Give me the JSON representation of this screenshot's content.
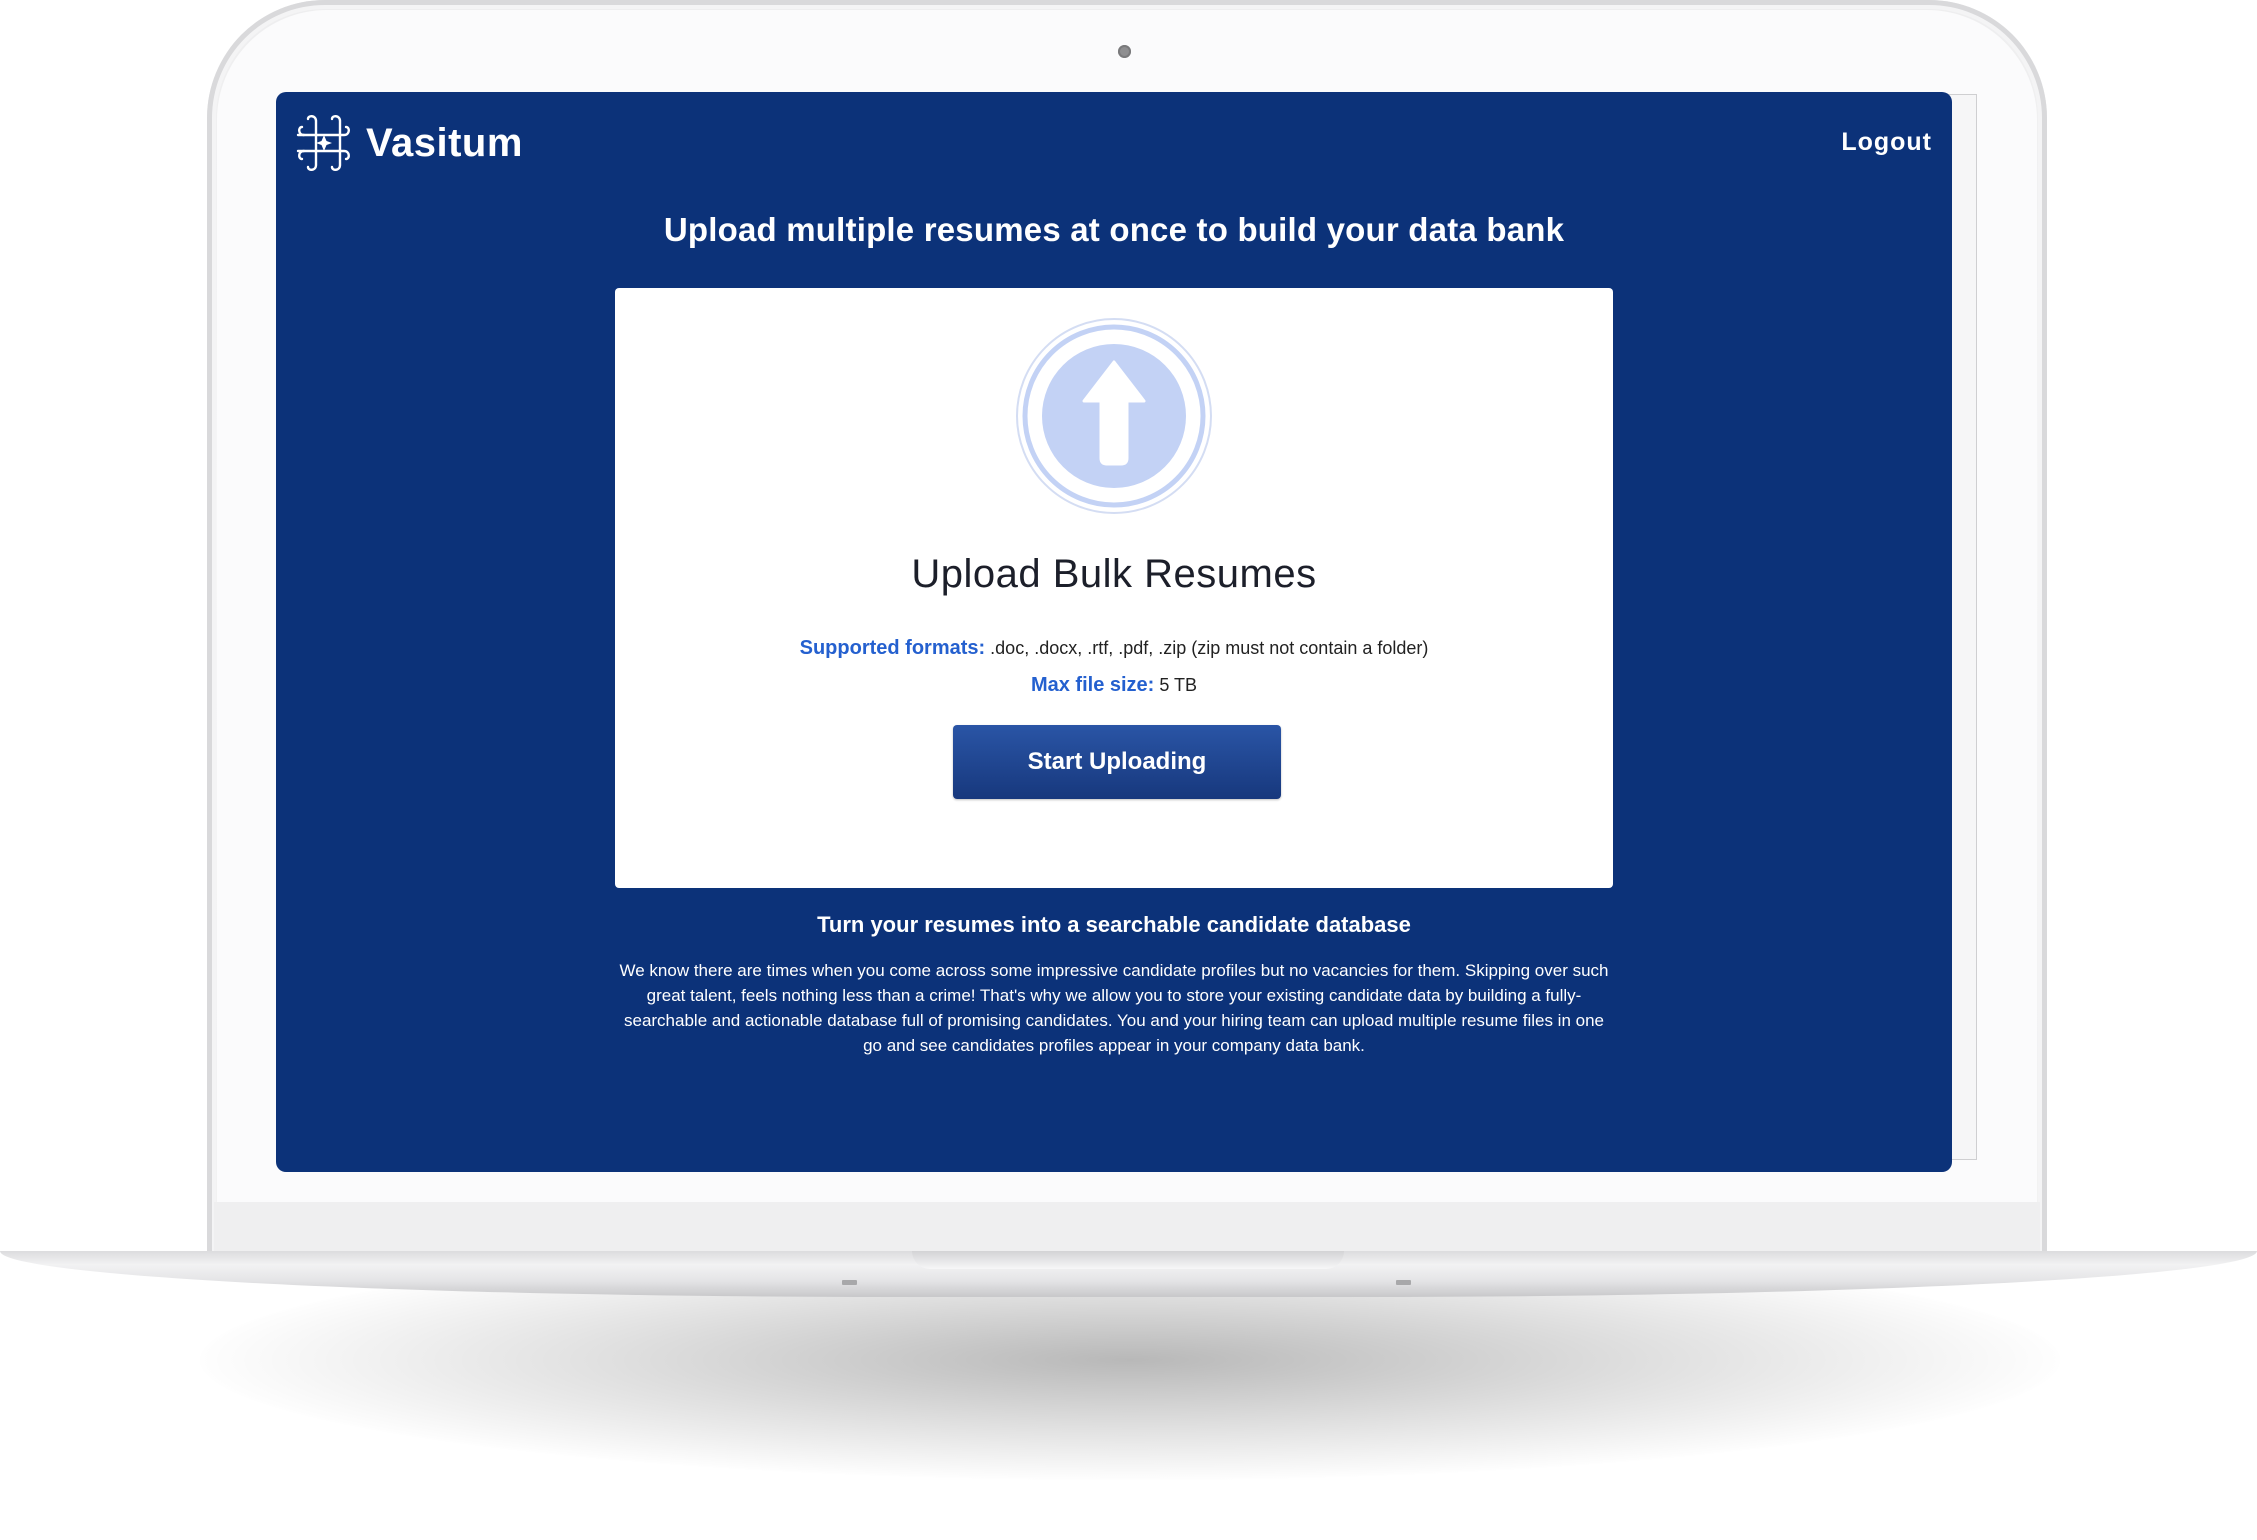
{
  "app": {
    "brand_name": "Vasitum",
    "logout_label": "Logout"
  },
  "page": {
    "headline": "Upload multiple resumes at once to build your data bank"
  },
  "upload_card": {
    "icon": "upload-arrow-icon",
    "title": "Upload Bulk Resumes",
    "formats_label": "Supported formats:",
    "formats_value": " .doc, .docx, .rtf, .pdf, .zip (zip must not contain a folder)",
    "max_size_label": "Max file size:",
    "max_size_value": " 5 TB",
    "button_label": "Start Uploading"
  },
  "info": {
    "title": "Turn your resumes into a searchable candidate database",
    "description": "We know there are times when you come across some impressive candidate profiles but no vacancies for them. Skipping over such great talent, feels nothing less than a crime! That's why we allow you to store your existing candidate data by building a fully-searchable and actionable database full of promising candidates. You and your hiring team can upload multiple resume files in one go and see candidates profiles appear in your company data bank."
  },
  "colors": {
    "screen_background": "#0c3279",
    "label_blue": "#2460cf",
    "button_blue": "#1f4690",
    "icon_light_blue": "#c3d2f5"
  }
}
